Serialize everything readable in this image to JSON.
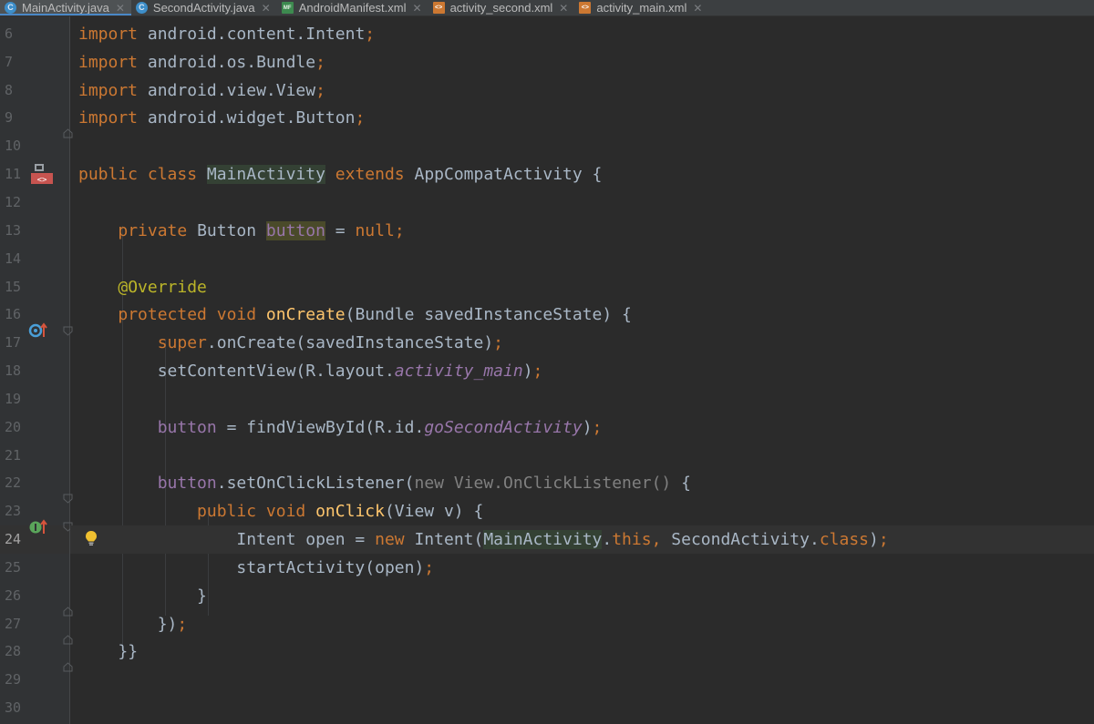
{
  "tabs": [
    {
      "label": "MainActivity.java",
      "icon": "java-class-icon",
      "active": true
    },
    {
      "label": "SecondActivity.java",
      "icon": "java-class-icon",
      "active": false
    },
    {
      "label": "AndroidManifest.xml",
      "icon": "manifest-icon",
      "active": false
    },
    {
      "label": "activity_second.xml",
      "icon": "layout-xml-icon",
      "active": false
    },
    {
      "label": "activity_main.xml",
      "icon": "layout-xml-icon",
      "active": false
    }
  ],
  "line_numbers": [
    "6",
    "7",
    "8",
    "9",
    "10",
    "11",
    "12",
    "13",
    "14",
    "15",
    "16",
    "17",
    "18",
    "19",
    "20",
    "21",
    "22",
    "23",
    "24",
    "25",
    "26",
    "27",
    "28",
    "29",
    "30"
  ],
  "current_line": "24",
  "code": {
    "l6": {
      "kw": "import",
      "rest": " android.content.Intent",
      "semi": ";"
    },
    "l7": {
      "kw": "import",
      "rest": " android.os.Bundle",
      "semi": ";"
    },
    "l8": {
      "kw": "import",
      "rest": " android.view.View",
      "semi": ";"
    },
    "l9": {
      "kw": "import",
      "rest": " android.widget.Button",
      "semi": ";"
    },
    "l11": {
      "kw1": "public class ",
      "cls": "MainActivity",
      "kw2": " extends ",
      "sup": "AppCompatActivity {"
    },
    "l13": {
      "kw": "private ",
      "type": "Button ",
      "field": "button",
      "op": " = ",
      "nul": "null",
      "semi": ";"
    },
    "l15": {
      "ann": "@Override"
    },
    "l16": {
      "kw": "protected void ",
      "fn": "onCreate",
      "rest": "(Bundle savedInstanceState) {"
    },
    "l17": {
      "kw": "super",
      "rest": ".onCreate(savedInstanceState)",
      "semi": ";"
    },
    "l18": {
      "a": "setContentView(R.layout.",
      "c": "activity_main",
      "b": ")",
      "semi": ";"
    },
    "l20": {
      "field": "button",
      "a": " = findViewById(R.id.",
      "c": "goSecondActivity",
      "b": ")",
      "semi": ";"
    },
    "l22": {
      "field": "button",
      "a": ".setOnClickListener(",
      "dim": "new View.OnClickListener() ",
      "b": "{"
    },
    "l23": {
      "kw": "public void ",
      "fn": "onClick",
      "rest": "(View v) {"
    },
    "l24": {
      "a": "Intent open = ",
      "kw": "new ",
      "b": "Intent(",
      "cls": "MainActivity",
      "c": ".",
      "this": "this",
      ", ": ", ",
      "d": "SecondActivity.",
      "class": "class",
      "e": ")",
      "semi": ";"
    },
    "l25": {
      "a": "startActivity(open)",
      "semi": ";"
    },
    "l26": {
      "a": "}"
    },
    "l27": {
      "a": "})",
      "semi": ";"
    },
    "l28": {
      "a": "}}"
    }
  },
  "colors": {
    "background": "#2b2b2b",
    "keyword": "#cc7832",
    "annotation": "#bbb529",
    "method": "#ffc66d",
    "constant": "#9876aa",
    "text": "#a9b7c6"
  },
  "gutter_icons": {
    "class_marker": "layout-xml-icon",
    "override_marker": "overrides-method-icon",
    "implements_marker": "implements-method-icon",
    "intention_bulb": "lightbulb-icon"
  }
}
